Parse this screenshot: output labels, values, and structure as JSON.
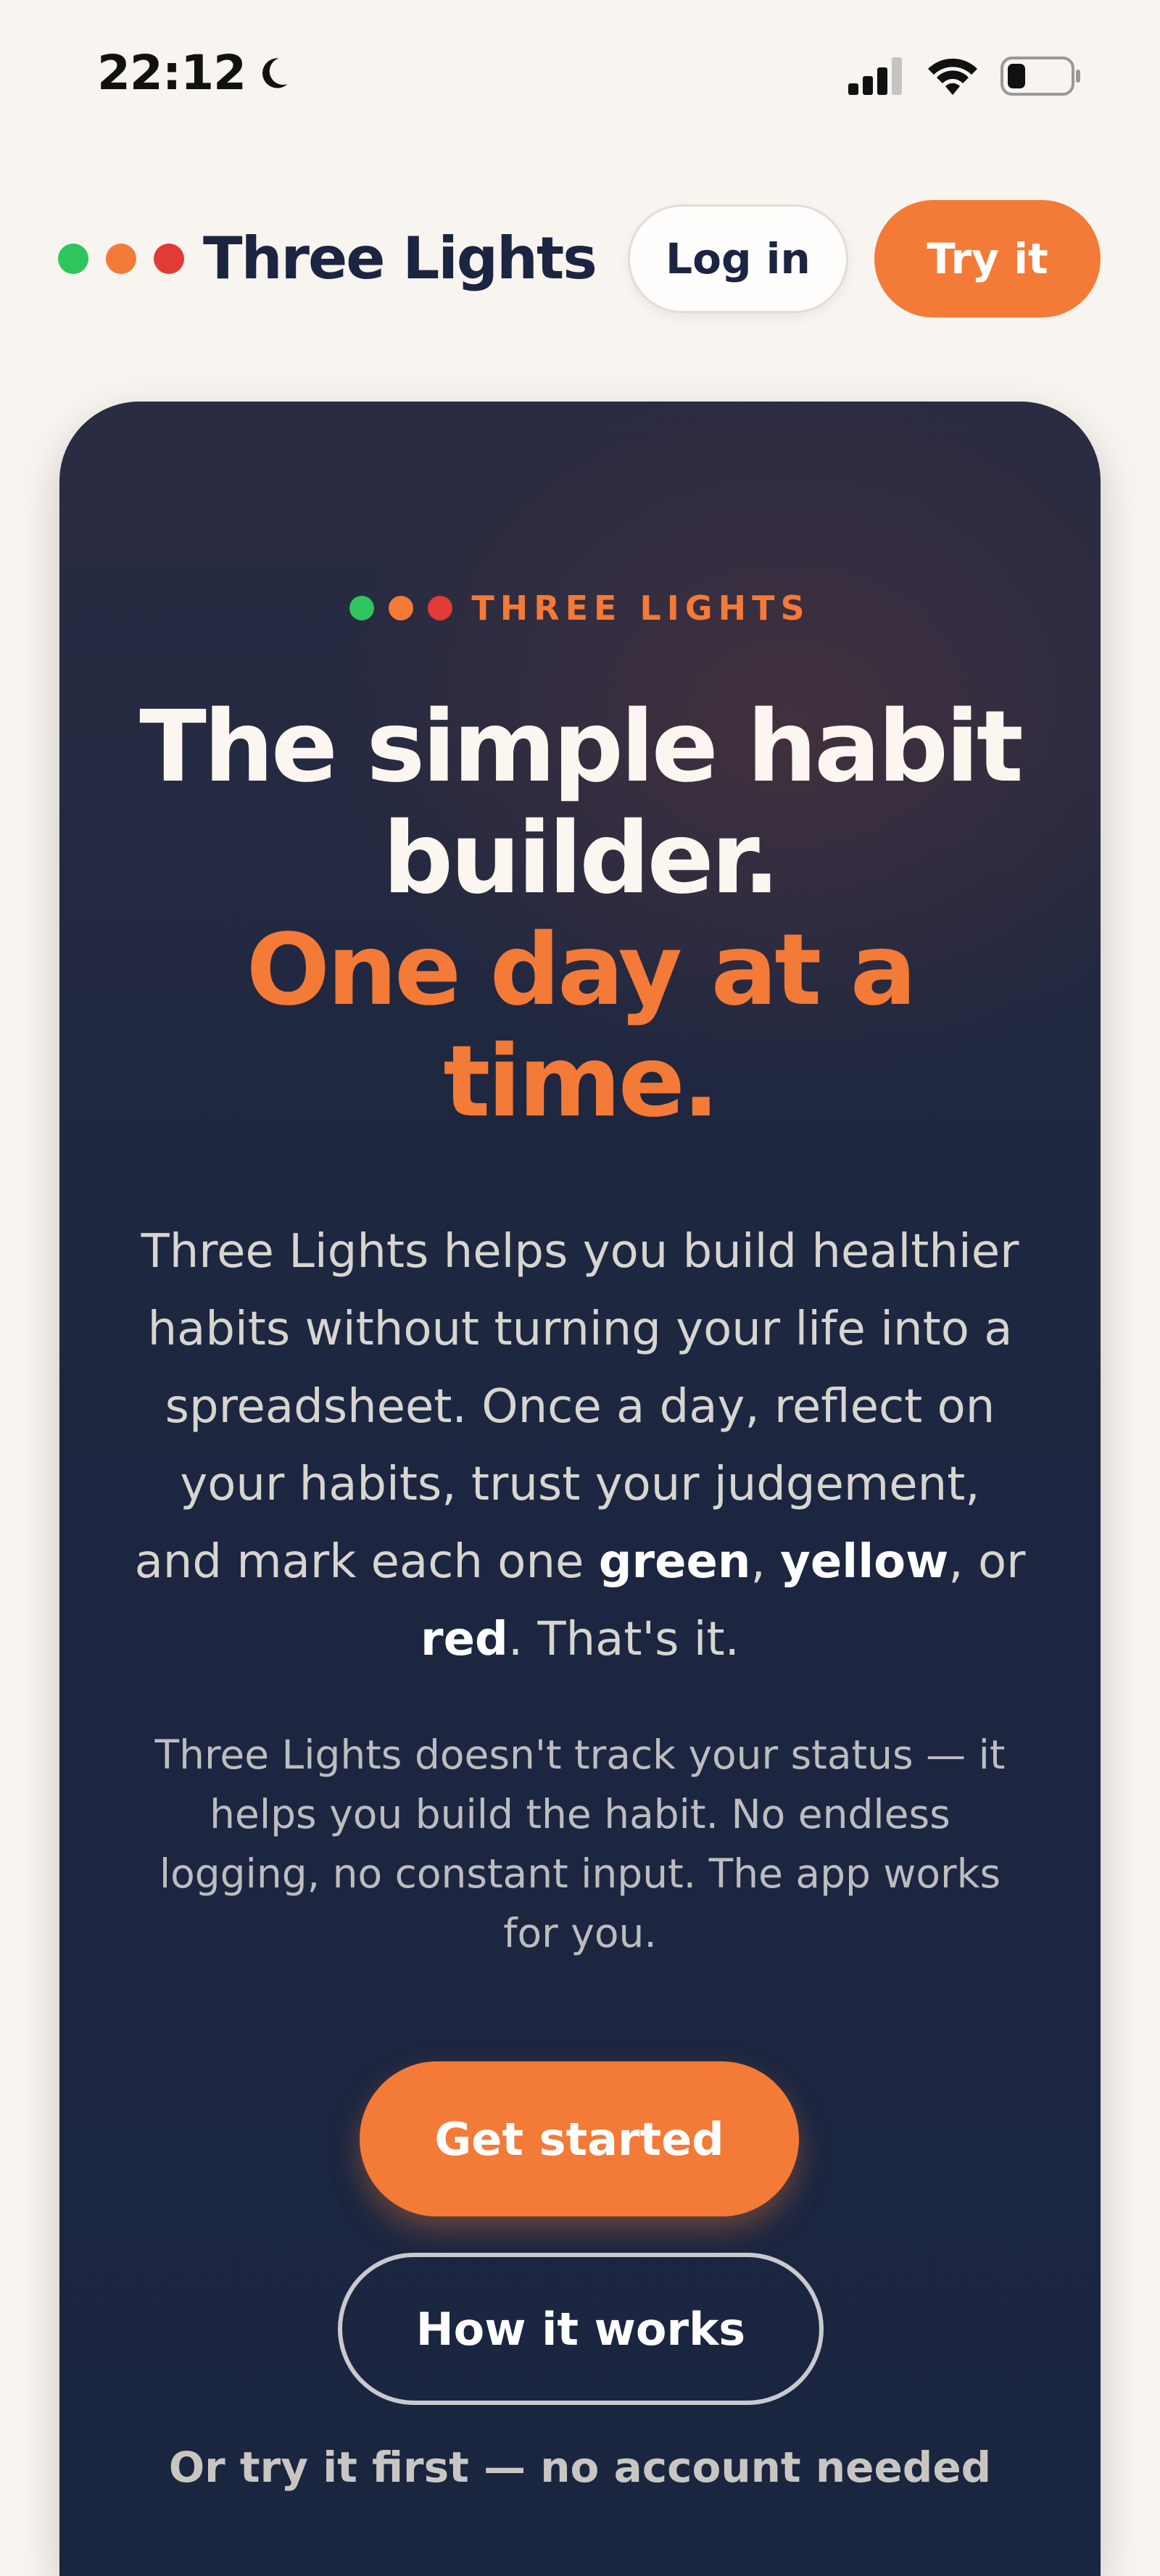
{
  "status_bar": {
    "time": "22:12",
    "icons": [
      "moon-icon",
      "signal-icon",
      "wifi-icon",
      "battery-icon"
    ]
  },
  "header": {
    "brand_name": "Three Lights",
    "login_label": "Log in",
    "try_label": "Try it"
  },
  "colors": {
    "green": "#2ec55e",
    "orange": "#f47a37",
    "red": "#e23a35",
    "navy": "#1b2440",
    "background": "#f8f4ef"
  },
  "hero": {
    "eyebrow": "THREE LIGHTS",
    "headline_line1": "The simple habit builder.",
    "headline_line2": "One day at a time.",
    "lead_part1": "Three Lights helps you build healthier habits without turning your life into a spreadsheet. Once a day, reflect on your habits, trust your judgement, and mark each one ",
    "lead_green": "green",
    "lead_sep1": ", ",
    "lead_yellow": "yellow",
    "lead_sep2": ", or ",
    "lead_red": "red",
    "lead_end": ". That's it.",
    "sub": "Three Lights doesn't track your status — it helps you build the habit. No endless logging, no constant input. The app works for you.",
    "cta_primary": "Get started",
    "cta_secondary": "How it works",
    "try_first": "Or try it first — no account needed"
  }
}
